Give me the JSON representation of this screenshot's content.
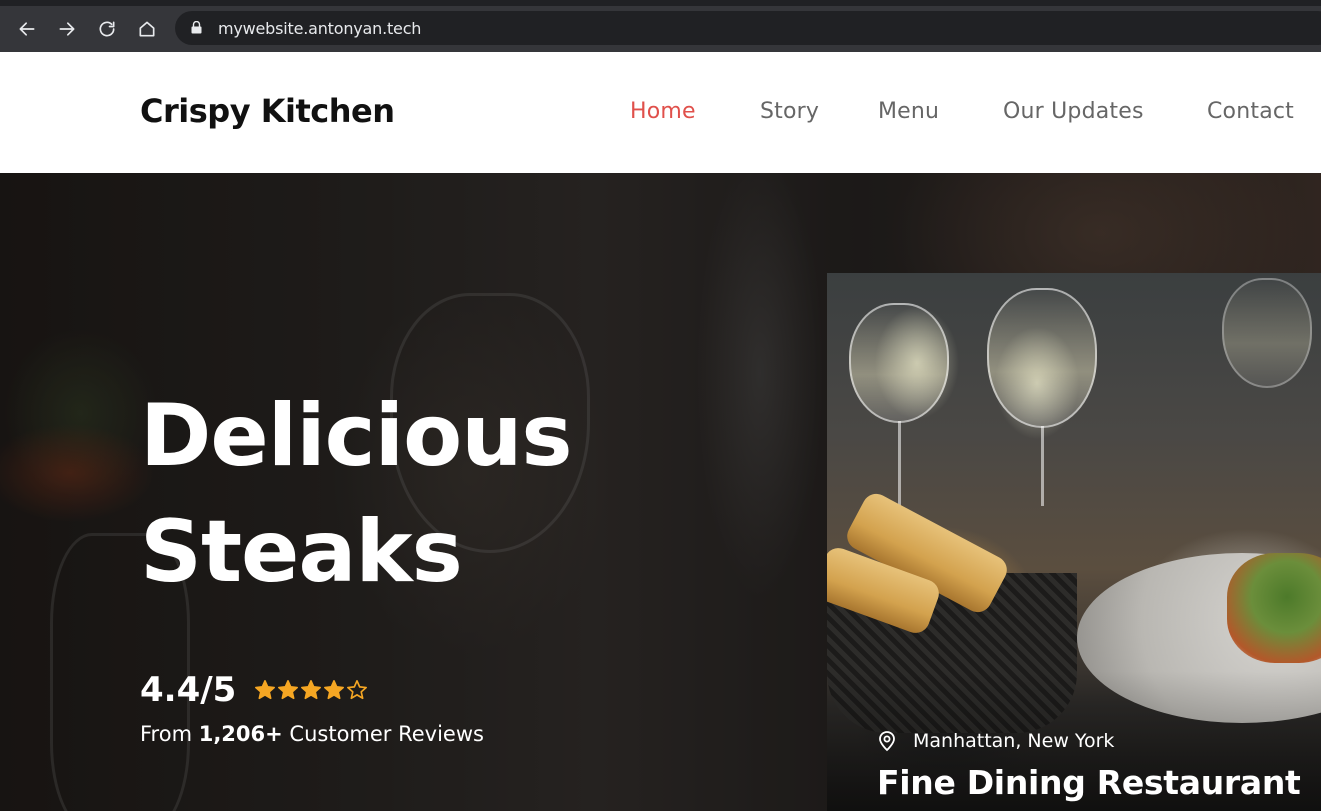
{
  "browser": {
    "url": "mywebsite.antonyan.tech",
    "icons": [
      "back-icon",
      "forward-icon",
      "reload-icon",
      "home-icon",
      "lock-icon"
    ]
  },
  "header": {
    "brand": "Crispy Kitchen",
    "nav": [
      {
        "label": "Home",
        "active": true
      },
      {
        "label": "Story",
        "active": false
      },
      {
        "label": "Menu",
        "active": false
      },
      {
        "label": "Our Updates",
        "active": false
      },
      {
        "label": "Contact",
        "active": false
      }
    ]
  },
  "hero": {
    "title_line1": "Delicious",
    "title_line2": "Steaks",
    "rating": "4.4/5",
    "rating_value": 4.4,
    "stars_filled": 4,
    "stars_total": 5,
    "reviews_prefix": "From ",
    "reviews_count": "1,206+",
    "reviews_suffix": " Customer Reviews"
  },
  "card": {
    "location": "Manhattan, New York",
    "title": "Fine Dining Restaurant"
  },
  "colors": {
    "accent": "#e0504b",
    "star": "#f5a623",
    "nav_text": "#666666",
    "brand_text": "#111111"
  }
}
